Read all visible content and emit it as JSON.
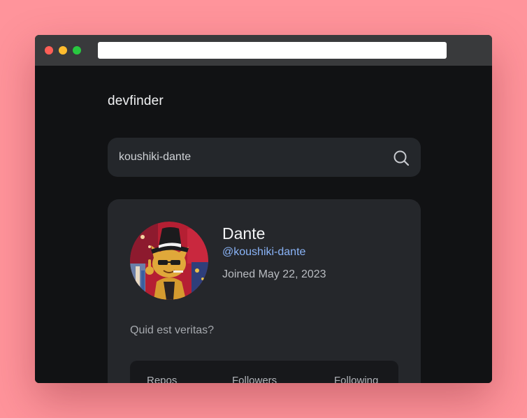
{
  "browser": {
    "address": ""
  },
  "app": {
    "brand": "devfinder"
  },
  "search": {
    "value": "koushiki-dante",
    "icon": "search-icon"
  },
  "profile": {
    "name": "Dante",
    "handle": "@koushiki-dante",
    "joined": "Joined May 22, 2023",
    "bio": "Quid est veritas?",
    "avatar_icon": "cat-avatar"
  },
  "stats": {
    "repos_label": "Repos",
    "followers_label": "Followers",
    "following_label": "Following"
  },
  "colors": {
    "background": "#ff949b",
    "app_bg": "#111214",
    "card_bg": "#25272b",
    "link": "#8ab4f8"
  }
}
